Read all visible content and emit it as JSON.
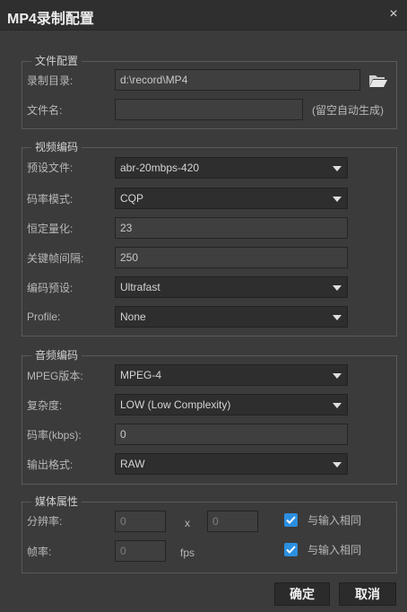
{
  "window": {
    "title": "MP4录制配置",
    "close_symbol": "×"
  },
  "file_config": {
    "legend": "文件配置",
    "record_dir_label": "录制目录:",
    "record_dir_value": "d:\\record\\MP4",
    "file_name_label": "文件名:",
    "file_name_value": "",
    "file_name_hint": "(留空自动生成)"
  },
  "video_encoding": {
    "legend": "视频编码",
    "preset_file_label": "预设文件:",
    "preset_file_value": "abr-20mbps-420",
    "rate_mode_label": "码率模式:",
    "rate_mode_value": "CQP",
    "quantizer_label": "恒定量化:",
    "quantizer_value": "23",
    "keyframe_label": "关键帧间隔:",
    "keyframe_value": "250",
    "encode_preset_label": "编码预设:",
    "encode_preset_value": "Ultrafast",
    "profile_label": "Profile:",
    "profile_value": "None"
  },
  "audio_encoding": {
    "legend": "音频编码",
    "mpeg_label": "MPEG版本:",
    "mpeg_value": "MPEG-4",
    "complexity_label": "复杂度:",
    "complexity_value": "LOW (Low Complexity)",
    "bitrate_label": "码率(kbps):",
    "bitrate_value": "0",
    "output_format_label": "输出格式:",
    "output_format_value": "RAW"
  },
  "media": {
    "legend": "媒体属性",
    "resolution_label": "分辨率:",
    "width_value": "0",
    "x_separator": "x",
    "height_value": "0",
    "same_as_input_1": "与输入相同",
    "framerate_label": "帧率:",
    "framerate_value": "0",
    "fps_unit": "fps",
    "same_as_input_2": "与输入相同"
  },
  "buttons": {
    "ok": "确定",
    "cancel": "取消"
  },
  "colors": {
    "background": "#3b3b3b",
    "titlebar": "#2f2f2f",
    "checkbox": "#2b8fe0"
  }
}
